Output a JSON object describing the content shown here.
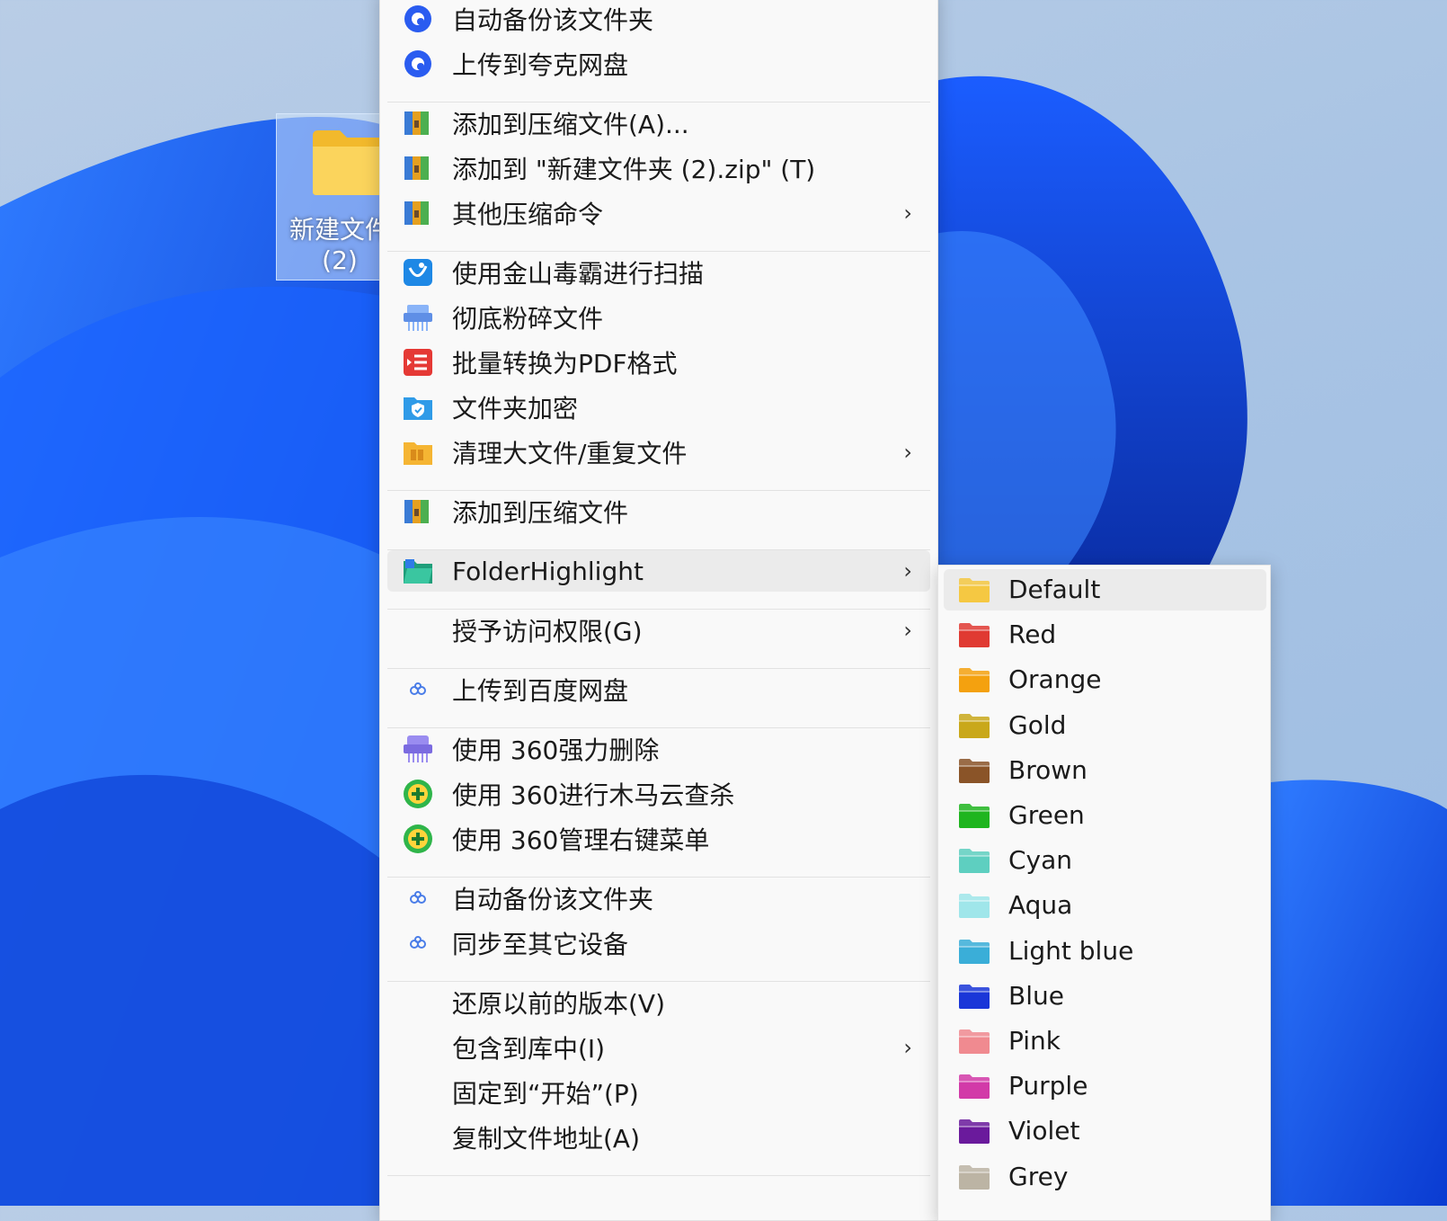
{
  "desktop": {
    "folder_name_line1": "新建文件",
    "folder_name_line2": "(2)"
  },
  "context_menu": {
    "items": [
      {
        "label": "自动备份该文件夹",
        "icon": "quark-cloud-icon"
      },
      {
        "label": "上传到夸克网盘",
        "icon": "quark-cloud-icon"
      },
      {
        "label": "添加到压缩文件(A)...",
        "icon": "archive-icon"
      },
      {
        "label": "添加到 \"新建文件夹 (2).zip\" (T)",
        "icon": "archive-icon"
      },
      {
        "label": "其他压缩命令",
        "icon": "archive-icon"
      },
      {
        "label": "使用金山毒霸进行扫描",
        "icon": "antivirus-scan-icon"
      },
      {
        "label": "彻底粉碎文件",
        "icon": "shredder-icon"
      },
      {
        "label": "批量转换为PDF格式",
        "icon": "pdf-convert-icon"
      },
      {
        "label": "文件夹加密",
        "icon": "folder-lock-icon"
      },
      {
        "label": "清理大文件/重复文件",
        "icon": "folder-clean-icon"
      },
      {
        "label": "添加到压缩文件",
        "icon": "archive-icon"
      },
      {
        "label": "FolderHighlight",
        "icon": "folderhighlight-icon"
      },
      {
        "label": "授予访问权限(G)",
        "icon": ""
      },
      {
        "label": "上传到百度网盘",
        "icon": "baidu-cloud-icon"
      },
      {
        "label": "使用 360强力删除",
        "icon": "shredder-360-icon"
      },
      {
        "label": "使用 360进行木马云查杀",
        "icon": "360-security-icon"
      },
      {
        "label": "使用 360管理右键菜单",
        "icon": "360-security-icon"
      },
      {
        "label": "自动备份该文件夹",
        "icon": "baidu-cloud-icon"
      },
      {
        "label": "同步至其它设备",
        "icon": "baidu-cloud-icon"
      },
      {
        "label": "还原以前的版本(V)",
        "icon": ""
      },
      {
        "label": "包含到库中(I)",
        "icon": ""
      },
      {
        "label": "固定到“开始”(P)",
        "icon": ""
      },
      {
        "label": "复制文件地址(A)",
        "icon": ""
      }
    ],
    "chevron": "›"
  },
  "submenu": {
    "items": [
      {
        "label": "Default",
        "color": "#f5c842"
      },
      {
        "label": "Red",
        "color": "#e03a32"
      },
      {
        "label": "Orange",
        "color": "#f4a10f"
      },
      {
        "label": "Gold",
        "color": "#c9a81a"
      },
      {
        "label": "Brown",
        "color": "#8a5428"
      },
      {
        "label": "Green",
        "color": "#1fb51f"
      },
      {
        "label": "Cyan",
        "color": "#5ecfc0"
      },
      {
        "label": "Aqua",
        "color": "#9fe6ea"
      },
      {
        "label": "Light blue",
        "color": "#3aaed8"
      },
      {
        "label": "Blue",
        "color": "#1a36d8"
      },
      {
        "label": "Pink",
        "color": "#f08a90"
      },
      {
        "label": "Purple",
        "color": "#d23aa8"
      },
      {
        "label": "Violet",
        "color": "#6a1a9c"
      },
      {
        "label": "Grey",
        "color": "#bcb4a4"
      }
    ]
  }
}
